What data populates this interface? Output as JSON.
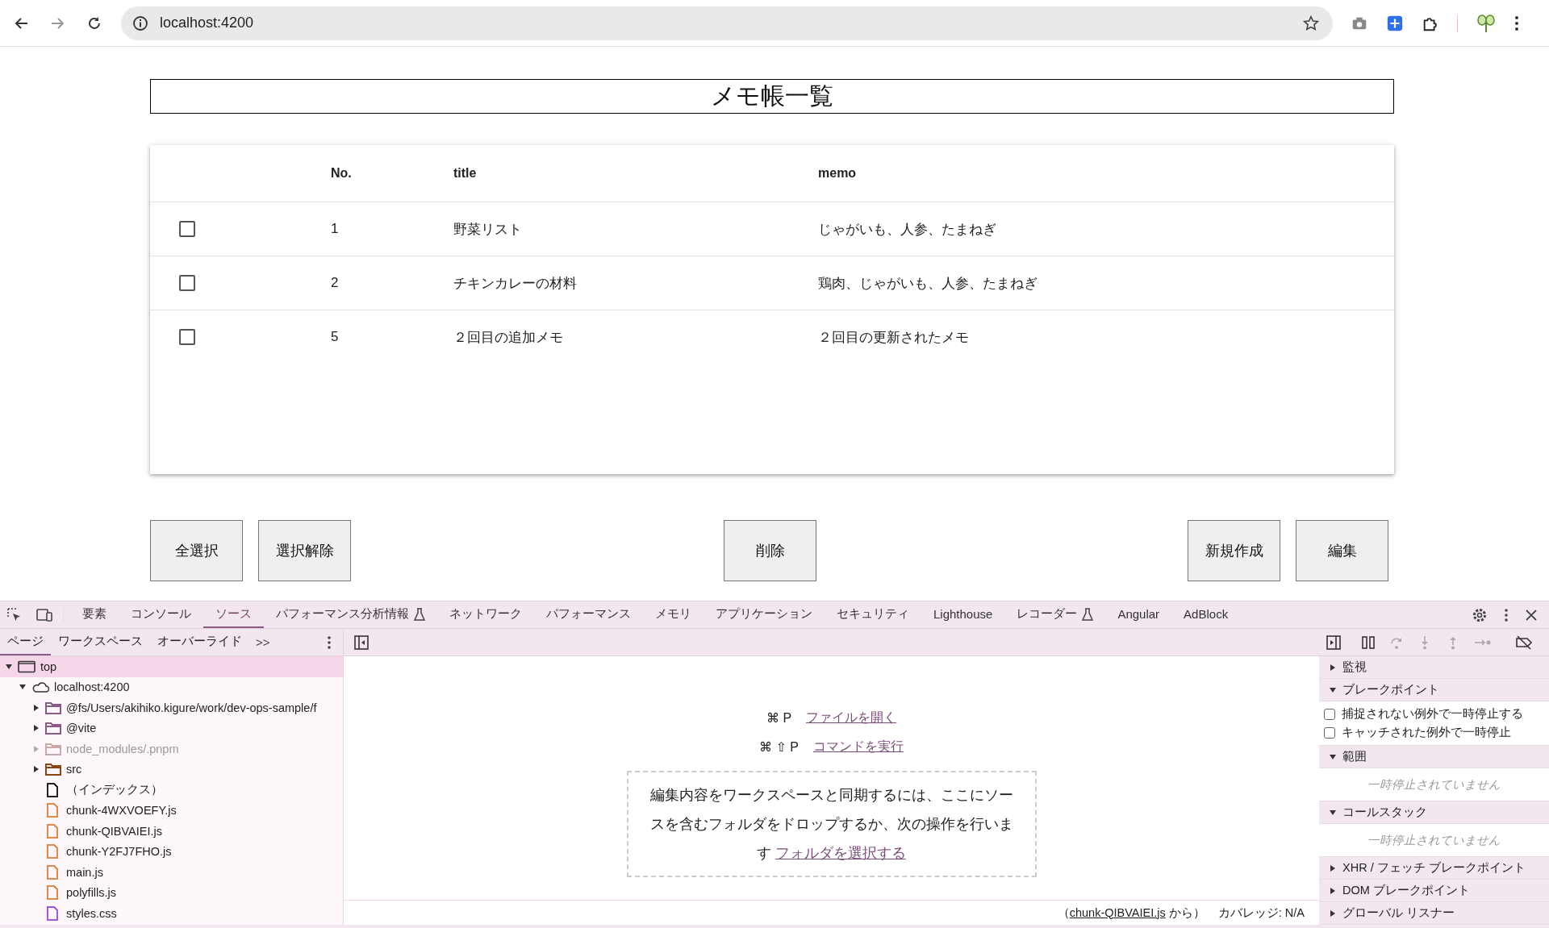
{
  "browser": {
    "url": "localhost:4200"
  },
  "page": {
    "title": "メモ帳一覧",
    "table": {
      "columns": [
        "No.",
        "title",
        "memo"
      ],
      "rows": [
        {
          "checked": false,
          "no": "1",
          "title": "野菜リスト",
          "memo": "じゃがいも、人参、たまねぎ"
        },
        {
          "checked": false,
          "no": "2",
          "title": "チキンカレーの材料",
          "memo": "鶏肉、じゃがいも、人参、たまねぎ"
        },
        {
          "checked": false,
          "no": "5",
          "title": "２回目の追加メモ",
          "memo": "２回目の更新されたメモ"
        }
      ]
    },
    "left_buttons": [
      "全選択",
      "選択解除"
    ],
    "center_buttons": [
      "削除"
    ],
    "right_buttons": [
      "新規作成",
      "編集"
    ]
  },
  "devtools": {
    "tabs": [
      {
        "label": "要素",
        "selected": false,
        "experimental": false
      },
      {
        "label": "コンソール",
        "selected": false,
        "experimental": false
      },
      {
        "label": "ソース",
        "selected": true,
        "experimental": false
      },
      {
        "label": "パフォーマンス分析情報",
        "selected": false,
        "experimental": true
      },
      {
        "label": "ネットワーク",
        "selected": false,
        "experimental": false
      },
      {
        "label": "パフォーマンス",
        "selected": false,
        "experimental": false
      },
      {
        "label": "メモリ",
        "selected": false,
        "experimental": false
      },
      {
        "label": "アプリケーション",
        "selected": false,
        "experimental": false
      },
      {
        "label": "セキュリティ",
        "selected": false,
        "experimental": false
      },
      {
        "label": "Lighthouse",
        "selected": false,
        "experimental": false
      },
      {
        "label": "レコーダー",
        "selected": false,
        "experimental": true
      },
      {
        "label": "Angular",
        "selected": false,
        "experimental": false
      },
      {
        "label": "AdBlock",
        "selected": false,
        "experimental": false
      }
    ],
    "sub_tabs": [
      {
        "label": "ページ",
        "selected": true
      },
      {
        "label": "ワークスペース",
        "selected": false
      },
      {
        "label": "オーバーライド",
        "selected": false
      }
    ],
    "more_tabs": ">>",
    "tree": [
      {
        "label": "top",
        "kind": "frame",
        "expanded": true,
        "selected": true,
        "dimmed": false,
        "children": [
          {
            "label": "localhost:4200",
            "kind": "origin",
            "expanded": true,
            "selected": false,
            "dimmed": false,
            "children": [
              {
                "label": "@fs/Users/akihiko.kigure/work/dev-ops-sample/f",
                "kind": "folder",
                "color": "#8a5a88",
                "expanded": false,
                "selected": false,
                "dimmed": false
              },
              {
                "label": "@vite",
                "kind": "folder",
                "color": "#8a5a88",
                "expanded": false,
                "selected": false,
                "dimmed": false
              },
              {
                "label": "node_modules/.pnpm",
                "kind": "folder",
                "color": "#c9a9a4",
                "expanded": false,
                "selected": false,
                "dimmed": true
              },
              {
                "label": "src",
                "kind": "folder",
                "color": "#8b4513",
                "expanded": false,
                "selected": false,
                "dimmed": false
              },
              {
                "label": "（インデックス）",
                "kind": "file",
                "color": "#222222",
                "selected": false,
                "dimmed": false
              },
              {
                "label": "chunk-4WXVOEFY.js",
                "kind": "file",
                "color": "#e08a4a",
                "selected": false,
                "dimmed": false
              },
              {
                "label": "chunk-QIBVAIEI.js",
                "kind": "file",
                "color": "#e08a4a",
                "selected": false,
                "dimmed": false
              },
              {
                "label": "chunk-Y2FJ7FHO.js",
                "kind": "file",
                "color": "#e08a4a",
                "selected": false,
                "dimmed": false
              },
              {
                "label": "main.js",
                "kind": "file",
                "color": "#e08a4a",
                "selected": false,
                "dimmed": false
              },
              {
                "label": "polyfills.js",
                "kind": "file",
                "color": "#e08a4a",
                "selected": false,
                "dimmed": false
              },
              {
                "label": "styles.css",
                "kind": "file",
                "color": "#a45ad8",
                "selected": false,
                "dimmed": false
              }
            ]
          }
        ]
      }
    ],
    "editor": {
      "shortcuts": [
        {
          "keys": "⌘ P",
          "link": "ファイルを開く"
        },
        {
          "keys": "⌘ ⇧ P",
          "link": "コマンドを実行"
        }
      ],
      "drop_text": "編集内容をワークスペースと同期するには、ここにソースを含むフォルダをドロップするか、次の操作を行います",
      "drop_link": "フォルダを選択する"
    },
    "status": {
      "open": "（",
      "link": "chunk-QIBVAIEI.js",
      "close": " から）",
      "coverage": "カバレッジ: N/A"
    },
    "debugger": [
      {
        "label": "監視",
        "expanded": false
      },
      {
        "label": "ブレークポイント",
        "expanded": true,
        "kind": "checkboxes",
        "items": [
          {
            "label": "捕捉されない例外で一時停止する",
            "checked": false
          },
          {
            "label": "キャッチされた例外で一時停止",
            "checked": false
          }
        ]
      },
      {
        "label": "範囲",
        "expanded": true,
        "kind": "message",
        "message": "一時停止されていません"
      },
      {
        "label": "コールスタック",
        "expanded": true,
        "kind": "message",
        "message": "一時停止されていません"
      },
      {
        "label": "XHR / フェッチ ブレークポイント",
        "expanded": false
      },
      {
        "label": "DOM ブレークポイント",
        "expanded": false
      },
      {
        "label": "グローバル リスナー",
        "expanded": false
      }
    ]
  }
}
